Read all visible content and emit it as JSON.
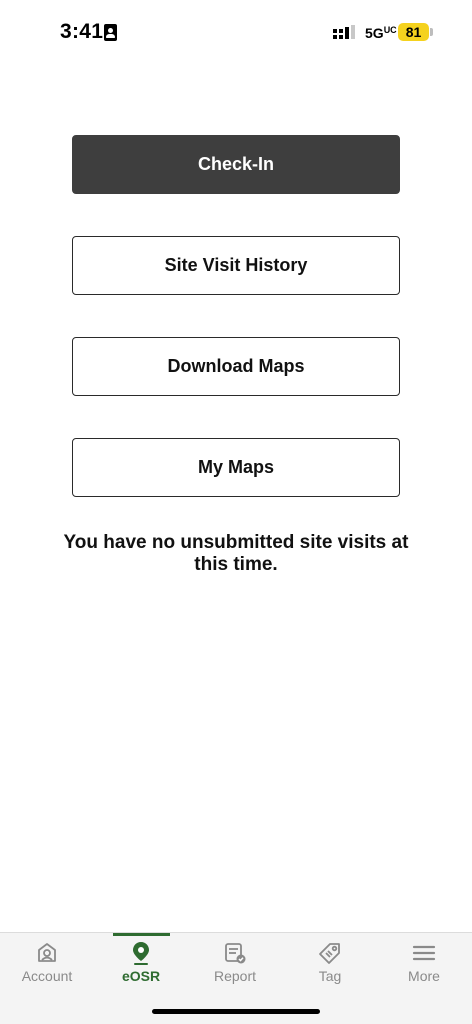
{
  "status_bar": {
    "time": "3:41",
    "network": "5G",
    "network_suffix": "UC",
    "battery": "81",
    "battery_color": "#f5d21e"
  },
  "main": {
    "checkin_label": "Check-In",
    "history_label": "Site Visit History",
    "download_label": "Download Maps",
    "mymaps_label": "My Maps",
    "empty_message": "You have no unsubmitted site visits at this time."
  },
  "tabs": [
    {
      "label": "Account",
      "icon": "account-icon"
    },
    {
      "label": "eOSR",
      "icon": "map-pin-icon",
      "active": true
    },
    {
      "label": "Report",
      "icon": "report-icon"
    },
    {
      "label": "Tag",
      "icon": "tag-icon"
    },
    {
      "label": "More",
      "icon": "menu-icon"
    }
  ],
  "colors": {
    "primary_button": "#3e3e3e",
    "accent_green": "#2e6b30",
    "inactive_tab": "#8a8a8a"
  }
}
